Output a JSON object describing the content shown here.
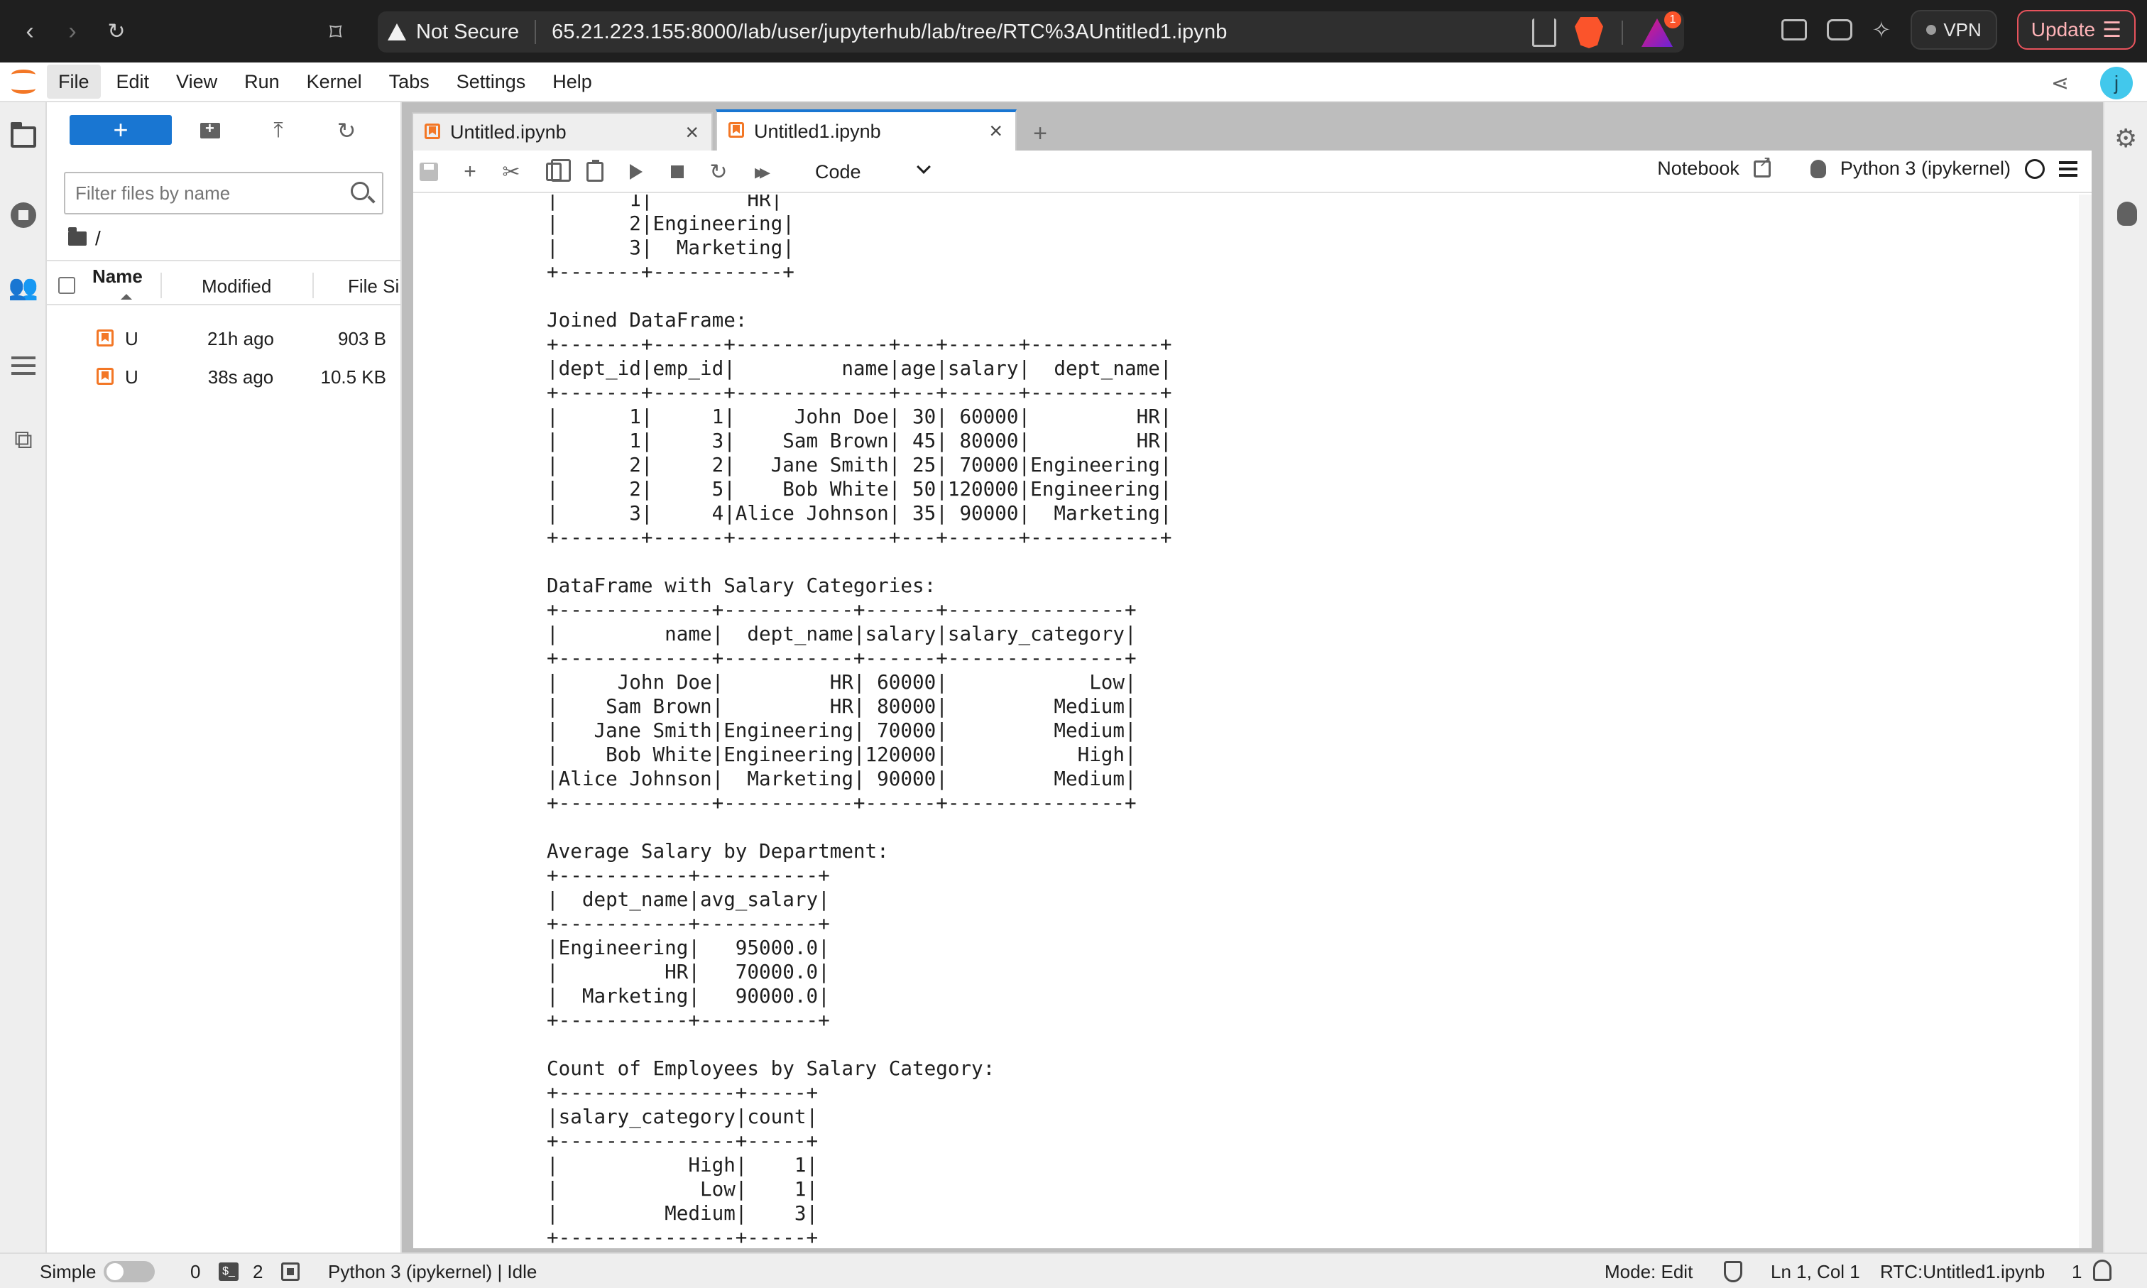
{
  "browser": {
    "security_label": "Not Secure",
    "url": "65.21.223.155:8000/lab/user/jupyterhub/lab/tree/RTC%3AUntitled1.ipynb",
    "rewards_badge": "1",
    "vpn_label": "VPN",
    "update_label": "Update"
  },
  "menubar": {
    "items": [
      "File",
      "Edit",
      "View",
      "Run",
      "Kernel",
      "Tabs",
      "Settings",
      "Help"
    ],
    "user_initial": "j"
  },
  "file_browser": {
    "new_label": "+",
    "filter_placeholder": "Filter files by name",
    "breadcrumb": "/",
    "columns": {
      "name": "Name",
      "modified": "Modified",
      "size": "File Si"
    },
    "rows": [
      {
        "name": "U",
        "modified": "21h ago",
        "size": "903 B"
      },
      {
        "name": "U",
        "modified": "38s ago",
        "size": "10.5 KB"
      }
    ]
  },
  "tabs": [
    {
      "label": "Untitled.ipynb",
      "active": false
    },
    {
      "label": "Untitled1.ipynb",
      "active": true
    }
  ],
  "notebook_toolbar": {
    "cell_type": "Code",
    "notebook_label": "Notebook",
    "kernel_name": "Python 3 (ipykernel)"
  },
  "output_text": "|      1|        HR|\n|      2|Engineering|\n|      3|  Marketing|\n+-------+-----------+\n\nJoined DataFrame:\n+-------+------+-------------+---+------+-----------+\n|dept_id|emp_id|         name|age|salary|  dept_name|\n+-------+------+-------------+---+------+-----------+\n|      1|     1|     John Doe| 30| 60000|         HR|\n|      1|     3|    Sam Brown| 45| 80000|         HR|\n|      2|     2|   Jane Smith| 25| 70000|Engineering|\n|      2|     5|    Bob White| 50|120000|Engineering|\n|      3|     4|Alice Johnson| 35| 90000|  Marketing|\n+-------+------+-------------+---+------+-----------+\n\nDataFrame with Salary Categories:\n+-------------+-----------+------+---------------+\n|         name|  dept_name|salary|salary_category|\n+-------------+-----------+------+---------------+\n|     John Doe|         HR| 60000|            Low|\n|    Sam Brown|         HR| 80000|         Medium|\n|   Jane Smith|Engineering| 70000|         Medium|\n|    Bob White|Engineering|120000|           High|\n|Alice Johnson|  Marketing| 90000|         Medium|\n+-------------+-----------+------+---------------+\n\nAverage Salary by Department:\n+-----------+----------+\n|  dept_name|avg_salary|\n+-----------+----------+\n|Engineering|   95000.0|\n|         HR|   70000.0|\n|  Marketing|   90000.0|\n+-----------+----------+\n\nCount of Employees by Salary Category:\n+---------------+-----+\n|salary_category|count|\n+---------------+-----+\n|           High|    1|\n|            Low|    1|\n|         Medium|    3|\n+---------------+-----+",
  "status_bar": {
    "mode_simple": "Simple",
    "count_a": "0",
    "count_b": "2",
    "kernel_status": "Python 3 (ipykernel) | Idle",
    "mode_edit": "Mode: Edit",
    "cursor": "Ln 1, Col 1",
    "file": "RTC:Untitled1.ipynb",
    "notifications": "1"
  }
}
